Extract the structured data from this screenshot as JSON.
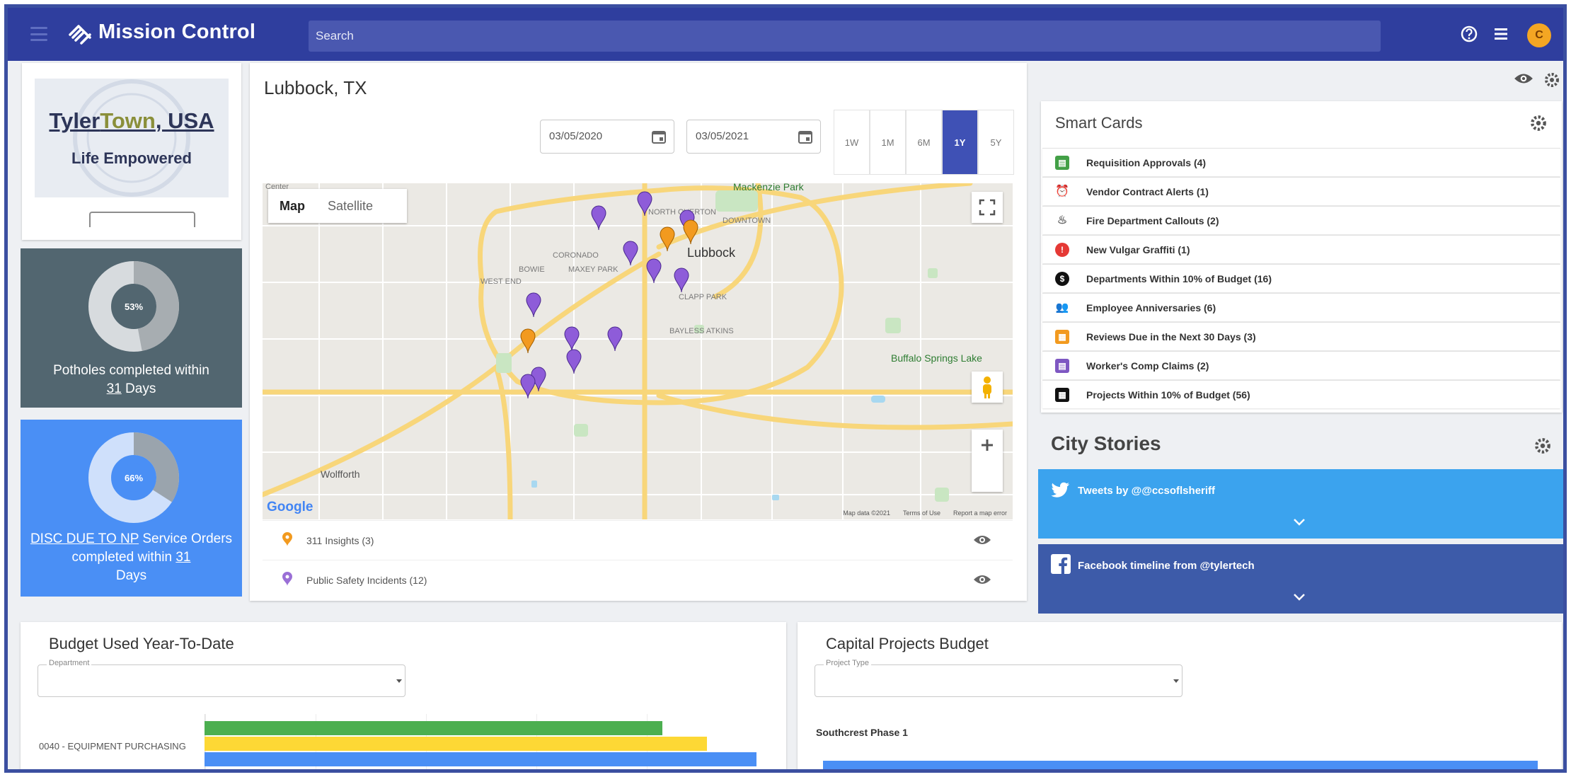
{
  "header": {
    "app_title": "Mission Control",
    "search_placeholder": "Search",
    "avatar_initial": "C"
  },
  "town": {
    "name_part1": "Tyler",
    "name_part2": "Town",
    "name_part3": ", USA",
    "tagline": "Life Empowered"
  },
  "kpis": [
    {
      "percent_label": "53%",
      "percent": 53,
      "text_before": "Potholes completed within ",
      "days": "31",
      "text_after": " Days",
      "color": "#526670"
    },
    {
      "percent_label": "66%",
      "percent": 66,
      "link_text": "DISC DUE TO NP",
      "text_before": " Service Orders completed within ",
      "days": "31",
      "text_after": " Days",
      "color": "#4a8ff5"
    }
  ],
  "map_card": {
    "title": "Lubbock, TX",
    "start_date": "03/05/2020",
    "end_date": "03/05/2021",
    "ranges": [
      "1W",
      "1M",
      "6M",
      "1Y",
      "5Y"
    ],
    "active_range": "1Y",
    "map_tab_active": "Map",
    "map_tab_inactive": "Satellite",
    "map_labels": {
      "lubbock": "Lubbock",
      "buffalo": "Buffalo Springs Lake",
      "wolfforth": "Wolfforth",
      "mackenzie": "Mackenzie Park",
      "north_overton": "NORTH OVERTON",
      "downtown": "DOWNTOWN",
      "coronado": "CORONADO",
      "bowie": "BOWIE",
      "maxey_park": "MAXEY PARK",
      "west_end": "WEST END",
      "clapp_park": "CLAPP PARK",
      "bayless_atkins": "BAYLESS ATKINS",
      "center": "Center",
      "google": "Google"
    },
    "attribution": [
      "Map data ©2021",
      "Terms of Use",
      "Report a map error"
    ],
    "layers": [
      {
        "label": "311 Insights (3)",
        "color": "#f29a1f"
      },
      {
        "label": "Public Safety Incidents (12)",
        "color": "#9a6fd6"
      }
    ]
  },
  "smart_cards": {
    "title": "Smart Cards",
    "items": [
      {
        "label": "Requisition Approvals (4)",
        "icon": "clipboard-icon",
        "color": "#43a047"
      },
      {
        "label": "Vendor Contract Alerts (1)",
        "icon": "alarm-icon",
        "color": "#e53935"
      },
      {
        "label": "Fire Department Callouts (2)",
        "icon": "fire-icon",
        "color": "#666666"
      },
      {
        "label": "New Vulgar Graffiti (1)",
        "icon": "alert-icon",
        "color": "#e53935"
      },
      {
        "label": "Departments Within 10% of Budget (16)",
        "icon": "dollar-icon",
        "color": "#111111"
      },
      {
        "label": "Employee Anniversaries (6)",
        "icon": "people-icon",
        "color": "#3f51b5"
      },
      {
        "label": "Reviews Due in the Next 30 Days (3)",
        "icon": "calendar-icon",
        "color": "#f29a1f"
      },
      {
        "label": "Worker's Comp Claims (2)",
        "icon": "document-icon",
        "color": "#7e57c2"
      },
      {
        "label": "Projects Within 10% of Budget (56)",
        "icon": "calendar-grid-icon",
        "color": "#111111"
      }
    ]
  },
  "city_stories": {
    "title": "City Stories",
    "twitter": "Tweets by @@ccsoflsheriff",
    "facebook": "Facebook timeline from @tylertech",
    "twitter_color": "#3ba3ee",
    "facebook_color": "#3d5ba9"
  },
  "budget": {
    "title": "Budget Used Year-To-Date",
    "select_label": "Department",
    "bar_label": "0040 - EQUIPMENT PURCHASING",
    "bars": [
      {
        "color": "#4caf50",
        "fraction": 0.83
      },
      {
        "color": "#fdd835",
        "fraction": 0.91
      },
      {
        "color": "#4a8ff5",
        "fraction": 1.0
      }
    ]
  },
  "capital": {
    "title": "Capital Projects Budget",
    "select_label": "Project Type",
    "project_label": "Southcrest Phase 1"
  }
}
